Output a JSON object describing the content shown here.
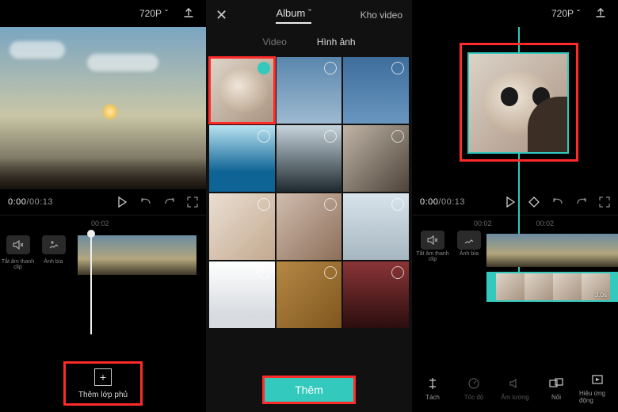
{
  "resolution_label": "720P",
  "panel1": {
    "time_current": "0:00",
    "time_total": "00:13",
    "ruler": [
      "00:02"
    ],
    "tools": {
      "mute_clip": "Tắt âm thanh clip",
      "cover": "Ảnh bìa"
    },
    "overlay_button": "Thêm lớp phủ"
  },
  "panel2": {
    "album_label": "Album",
    "stock_label": "Kho video",
    "tab_video": "Video",
    "tab_image": "Hình ảnh",
    "add_button": "Thêm"
  },
  "panel3": {
    "time_current": "0:00",
    "time_total": "00:13",
    "ruler": [
      "00:02",
      "00:02"
    ],
    "clip_duration": "3.0s",
    "tools": {
      "mute_clip": "Tắt âm thanh clip",
      "cover": "Ảnh bìa"
    },
    "toolbar": {
      "split": "Tách",
      "speed": "Tốc độ",
      "volume": "Âm lượng",
      "overlay": "Nối",
      "animation": "Hiệu ứng động"
    }
  }
}
